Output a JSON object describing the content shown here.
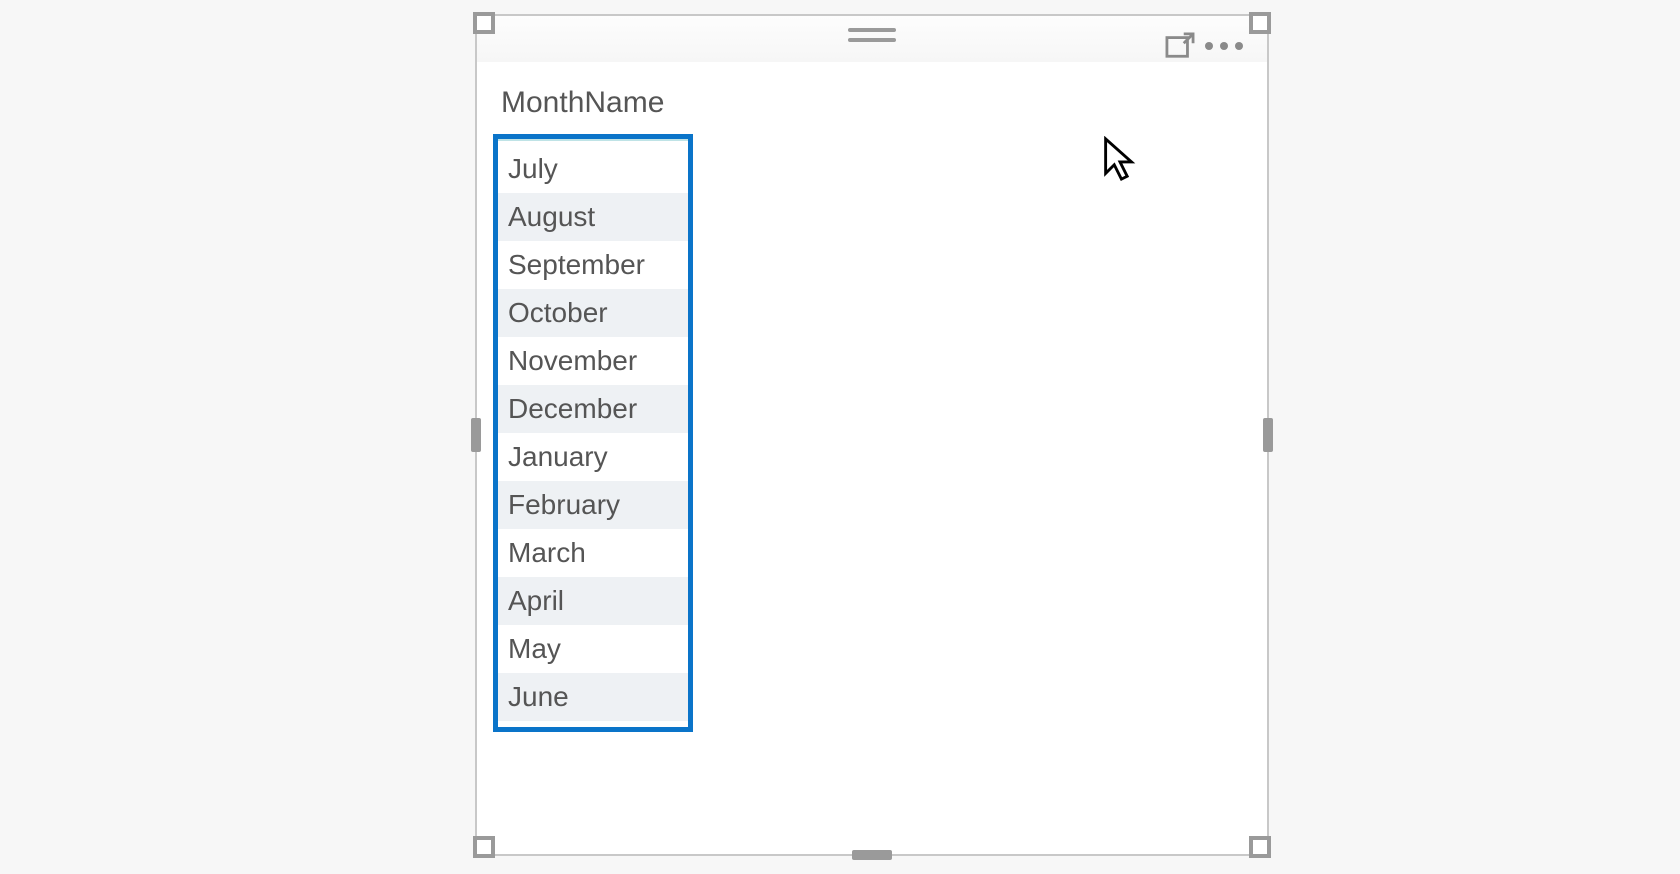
{
  "visual": {
    "column_header": "MonthName",
    "rows": [
      "July",
      "August",
      "September",
      "October",
      "November",
      "December",
      "January",
      "February",
      "March",
      "April",
      "May",
      "June"
    ]
  },
  "icons": {
    "focus": "focus-mode-icon",
    "more": "more-options-icon",
    "grip": "drag-grip-icon",
    "cursor": "mouse-cursor"
  },
  "colors": {
    "highlight": "#0a74c9",
    "handle": "#9a9a9a",
    "alt_row": "#eef1f4"
  }
}
